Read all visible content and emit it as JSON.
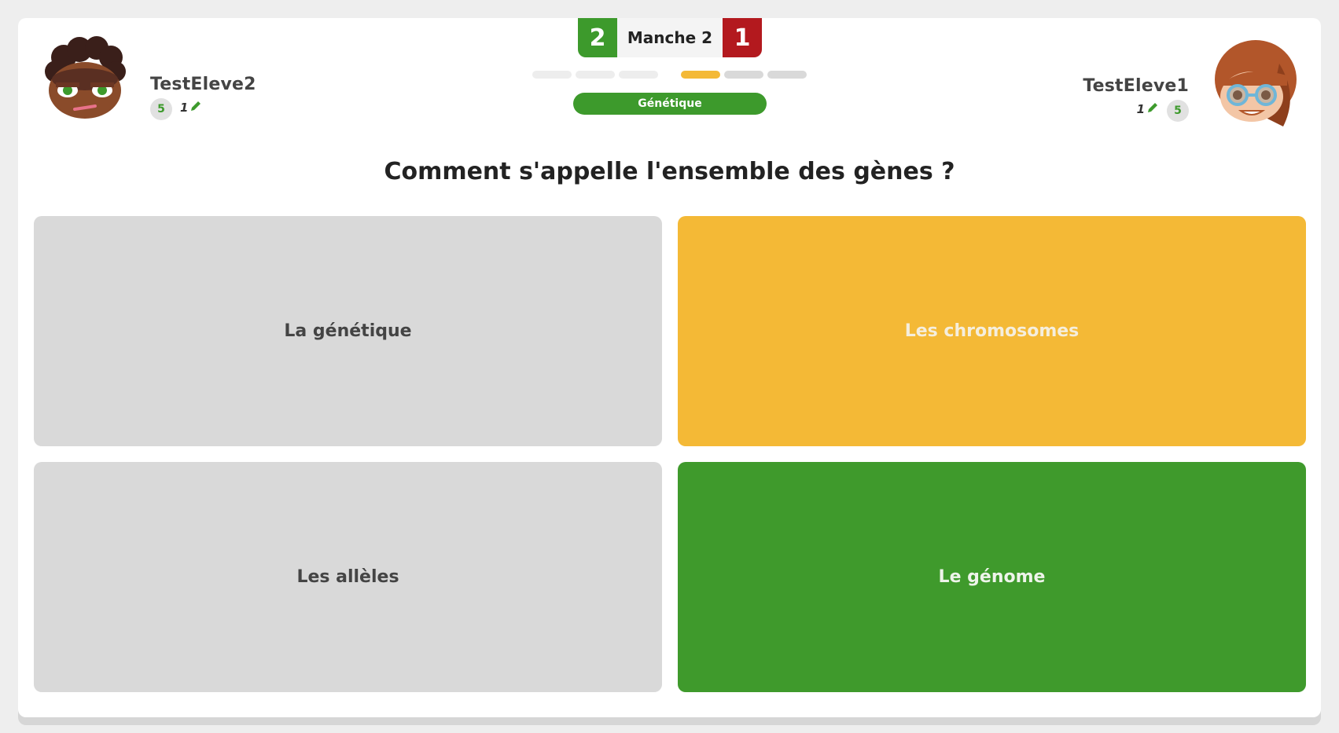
{
  "players": {
    "left": {
      "name": "TestEleve2",
      "level": "5",
      "pencil_count": "1",
      "avatar_icon": "boy-avatar-icon"
    },
    "right": {
      "name": "TestEleve1",
      "level": "5",
      "pencil_count": "1",
      "avatar_icon": "girl-avatar-icon"
    }
  },
  "score": {
    "left": "2",
    "right": "1",
    "round_label": "Manche 2"
  },
  "progress": {
    "left_segments": [
      "done",
      "done",
      "done"
    ],
    "right_segments": [
      "active",
      "pending",
      "pending"
    ]
  },
  "category": "Génétique",
  "question": "Comment s'appelle l'ensemble des gènes ?",
  "answers": [
    {
      "label": "La génétique",
      "state": "neutral"
    },
    {
      "label": "Les chromosomes",
      "state": "selected"
    },
    {
      "label": "Les allèles",
      "state": "neutral"
    },
    {
      "label": "Le génome",
      "state": "correct"
    }
  ],
  "colors": {
    "green": "#3d9a2c",
    "red": "#b3191e",
    "yellow": "#f4b936",
    "grey": "#d9d9d9"
  }
}
